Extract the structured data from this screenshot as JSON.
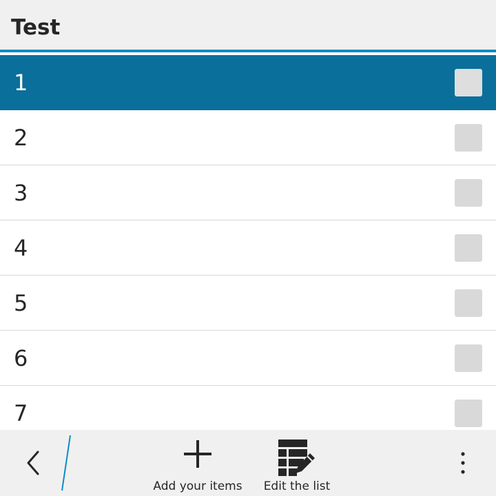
{
  "titlebar": {
    "title": "Test"
  },
  "list": {
    "items": [
      {
        "label": "1",
        "selected": true
      },
      {
        "label": "2",
        "selected": false
      },
      {
        "label": "3",
        "selected": false
      },
      {
        "label": "4",
        "selected": false
      },
      {
        "label": "5",
        "selected": false
      },
      {
        "label": "6",
        "selected": false
      },
      {
        "label": "7",
        "selected": false
      }
    ]
  },
  "actionbar": {
    "back_icon": "chevron-left-icon",
    "add_label": "Add your items",
    "add_icon": "plus-icon",
    "edit_label": "Edit the list",
    "edit_icon": "list-edit-icon",
    "overflow_icon": "more-vertical-icon"
  },
  "colors": {
    "accent": "#0a8bc6",
    "selected_row": "#0a6f9a",
    "bar_background": "#f0f0f0",
    "checkbox": "#d9d9d9"
  }
}
